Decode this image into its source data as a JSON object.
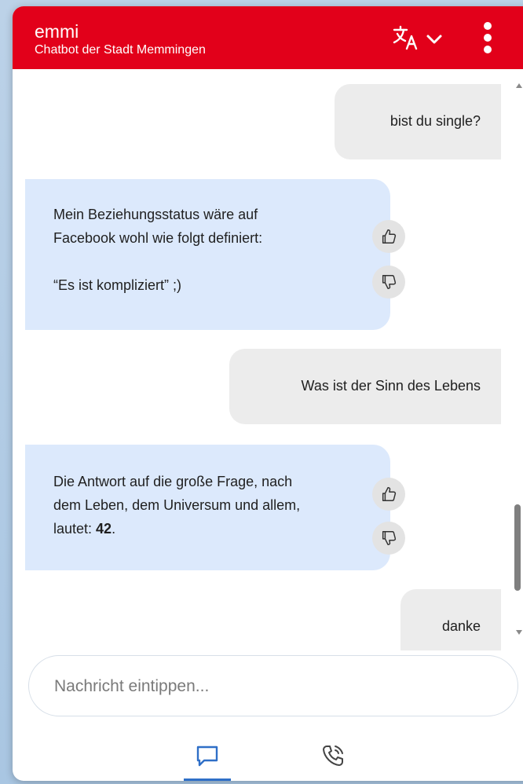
{
  "header": {
    "title": "emmi",
    "subtitle": "Chatbot der Stadt Memmingen",
    "translate_icon": "translate-icon",
    "chevron_icon": "chevron-down-icon",
    "menu_icon": "more-vertical-icon"
  },
  "messages": [
    {
      "role": "user",
      "text": "bist du single?"
    },
    {
      "role": "bot",
      "lines": [
        "Mein Beziehungsstatus wäre auf",
        "Facebook wohl wie folgt definiert:",
        "",
        "“Es ist kompliziert” ;)"
      ]
    },
    {
      "role": "user",
      "text": "Was ist der Sinn des Lebens"
    },
    {
      "role": "bot",
      "lines": [
        "Die Antwort auf die große Frage, nach",
        "dem Leben, dem Universum und allem,"
      ],
      "last_line_prefix": "lautet: ",
      "last_line_bold": "42",
      "last_line_suffix": "."
    },
    {
      "role": "user",
      "text": "danke"
    }
  ],
  "feedback": {
    "up_icon": "thumbs-up-icon",
    "down_icon": "thumbs-down-icon"
  },
  "input": {
    "placeholder": "Nachricht eintippen..."
  },
  "tabs": [
    {
      "name": "chat",
      "icon": "chat-bubble-icon",
      "active": true
    },
    {
      "name": "call",
      "icon": "phone-call-icon",
      "active": false
    }
  ],
  "colors": {
    "brand": "#e2001a",
    "user_bubble": "#ececec",
    "bot_bubble": "#dce9fc",
    "active_tab": "#2f6fc7"
  }
}
